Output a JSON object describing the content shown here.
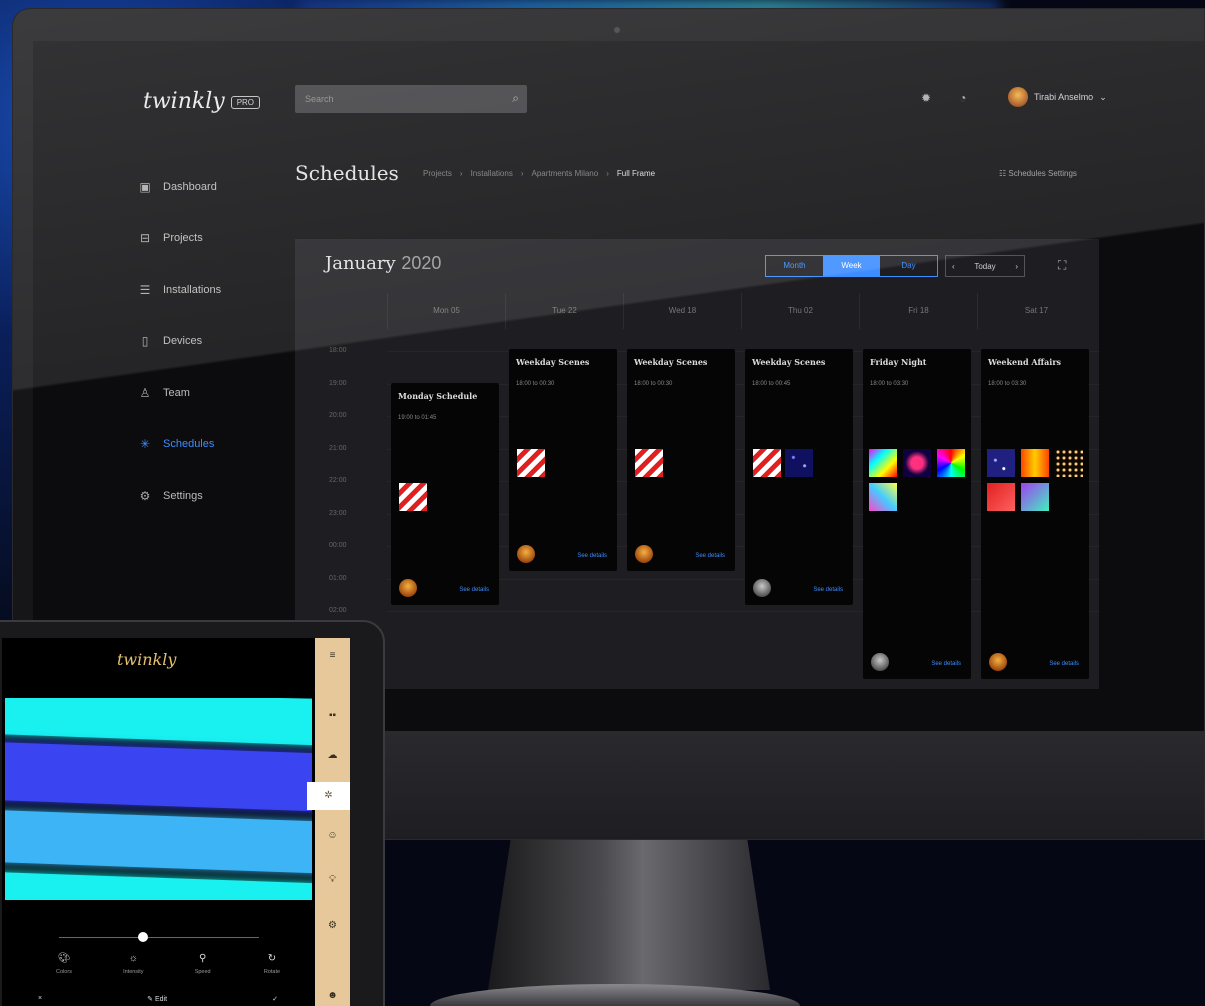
{
  "app": {
    "brand": "twinkly",
    "badge": "PRO"
  },
  "header": {
    "search_placeholder": "Search",
    "user_name": "Tirabi Anselmo"
  },
  "sidebar": {
    "items": [
      {
        "label": "Dashboard",
        "icon": "dashboard-icon"
      },
      {
        "label": "Projects",
        "icon": "projects-icon"
      },
      {
        "label": "Installations",
        "icon": "installations-icon"
      },
      {
        "label": "Devices",
        "icon": "devices-icon"
      },
      {
        "label": "Team",
        "icon": "team-icon"
      },
      {
        "label": "Schedules",
        "icon": "schedules-icon",
        "active": true
      },
      {
        "label": "Settings",
        "icon": "settings-icon"
      }
    ]
  },
  "page": {
    "title": "Schedules",
    "breadcrumb": [
      "Projects",
      "Installations",
      "Apartments Milano",
      "Full Frame"
    ],
    "schedule_settings": "Schedules Settings"
  },
  "calendar": {
    "month": "January",
    "year": "2020",
    "views": [
      "Month",
      "Week",
      "Day"
    ],
    "active_view": "Week",
    "today": "Today",
    "days": [
      "Mon 05",
      "Tue 22",
      "Wed 18",
      "Thu 02",
      "Fri 18",
      "Sat 17"
    ],
    "hours": [
      "18:00",
      "19:00",
      "20:00",
      "21:00",
      "22:00",
      "23:00",
      "00:00",
      "01:00",
      "02:00"
    ],
    "events": [
      {
        "title": "Monday Schedule",
        "time": "19:00 to 01:45",
        "link": "See details"
      },
      {
        "title": "Weekday Scenes",
        "time": "18:00 to 00:30",
        "link": "See details"
      },
      {
        "title": "Weekday Scenes",
        "time": "18:00 to 00:30",
        "link": "See details"
      },
      {
        "title": "Weekday Scenes",
        "time": "18:00 to 00:45",
        "link": "See details"
      },
      {
        "title": "Friday Night",
        "time": "18:00 to 03:30",
        "link": "See details"
      },
      {
        "title": "Weekend Affairs",
        "time": "18:00 to 03:30",
        "link": "See details"
      }
    ]
  },
  "tablet": {
    "brand": "twinkly",
    "controls": [
      {
        "label": "Colors",
        "icon": "palette-icon"
      },
      {
        "label": "Intensity",
        "icon": "sun-icon"
      },
      {
        "label": "Speed",
        "icon": "speed-icon"
      },
      {
        "label": "Rotate",
        "icon": "rotate-icon"
      }
    ],
    "slider_value": 0.42,
    "cancel": "×",
    "edit": "Edit",
    "confirm": "✓",
    "band_colors": [
      "#19f0f0",
      "#3a44f0",
      "#3cb4f5",
      "#19f0f0"
    ]
  }
}
